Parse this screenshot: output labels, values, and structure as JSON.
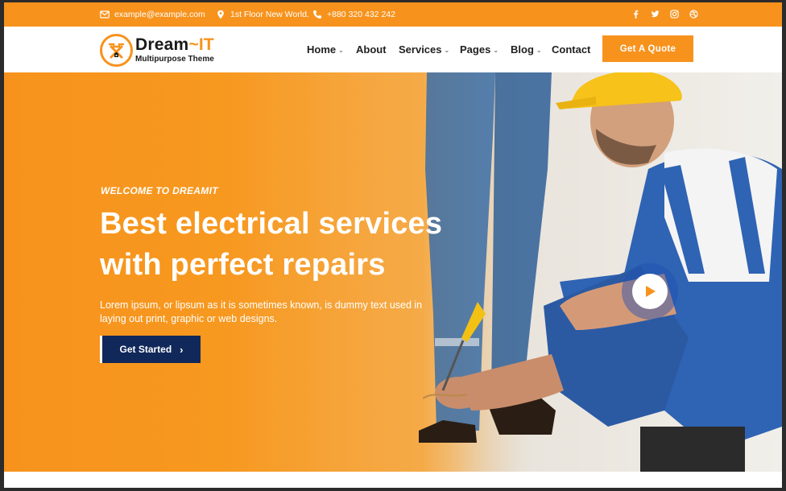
{
  "topbar": {
    "email": "example@example.com",
    "address": "1st Floor New World.",
    "phone": "+880 320 432 242",
    "social_icons": [
      "facebook-icon",
      "twitter-icon",
      "instagram-icon",
      "dribbble-icon"
    ]
  },
  "brand": {
    "name_part1": "Dream",
    "name_part2": "~IT",
    "tagline": "Multipurpose Theme",
    "accent_color": "#f7931d",
    "dark_color": "#11285a"
  },
  "nav": {
    "items": [
      {
        "label": "Home",
        "has_dropdown": true
      },
      {
        "label": "About",
        "has_dropdown": false
      },
      {
        "label": "Services",
        "has_dropdown": true
      },
      {
        "label": "Pages",
        "has_dropdown": true
      },
      {
        "label": "Blog",
        "has_dropdown": true
      },
      {
        "label": "Contact",
        "has_dropdown": false
      }
    ],
    "dropdown_glyph": "⌄",
    "quote_label": "Get A Quote"
  },
  "hero": {
    "kicker": "WELCOME TO DREAMIT",
    "title_line1": "Best electrical services",
    "title_line2": "with perfect repairs",
    "description": "Lorem ipsum, or lipsum as it is sometimes known, is dummy text used in laying out print, graphic or web designs.",
    "cta_label": "Get Started",
    "cta_glyph": "›"
  }
}
